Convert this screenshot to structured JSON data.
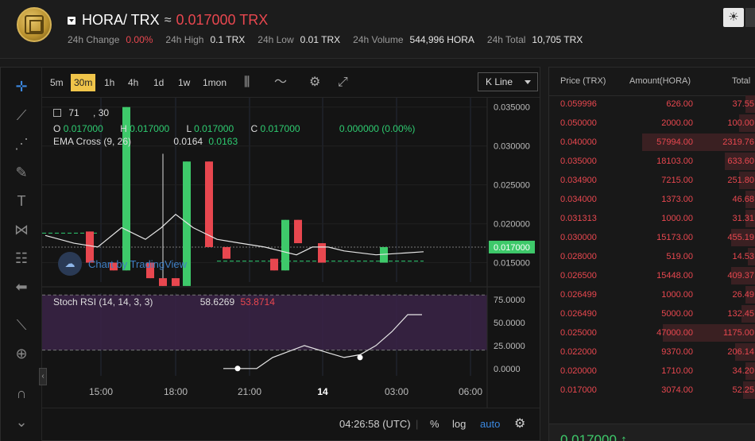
{
  "header": {
    "pair": "HORA/ TRX",
    "approx": "≈",
    "price": "0.017000 TRX",
    "stats": [
      {
        "label": "24h Change",
        "value": "0.00%",
        "red": true
      },
      {
        "label": "24h High",
        "value": "0.1 TRX"
      },
      {
        "label": "24h Low",
        "value": "0.01 TRX"
      },
      {
        "label": "24h Volume",
        "value": "544,996 HORA"
      },
      {
        "label": "24h Total",
        "value": "10,705 TRX"
      }
    ],
    "theme_icon": "sun-icon"
  },
  "toolbar": {
    "timeframes": [
      "5m",
      "30m",
      "1h",
      "4h",
      "1d",
      "1w",
      "1mon"
    ],
    "active_timeframe": "30m",
    "chart_type": "K Line"
  },
  "legend": {
    "volume_a": "71",
    "volume_b": ", 30",
    "o_label": "O",
    "o": "0.017000",
    "h_label": "H",
    "h": "0.017000",
    "l_label": "L",
    "l": "0.017000",
    "c_label": "C",
    "c": "0.017000",
    "change": "0.000000 (0.00%)",
    "ema_label": "EMA Cross (9, 26)",
    "ema_a": "0.0164",
    "ema_b": "0.0163"
  },
  "rsi": {
    "label": "Stoch RSI (14, 14, 3, 3)",
    "k": "58.6269",
    "d": "53.8714"
  },
  "watermark": "Chart by TradingView",
  "bottom": {
    "time": "04:26:58 (UTC)",
    "percent": "%",
    "log": "log",
    "auto": "auto"
  },
  "colors": {
    "up": "#3ec96a",
    "down": "#e8474f",
    "accent": "#f0c54a",
    "rsi_band": "#3a2347"
  },
  "chart_data": [
    {
      "type": "candlestick",
      "title": "",
      "x_ticks": [
        "15:00",
        "18:00",
        "21:00",
        "14",
        "03:00",
        "06:00"
      ],
      "y_ticks": [
        "0.035000",
        "0.030000",
        "0.025000",
        "0.020000",
        "0.015000"
      ],
      "ylim": [
        0.0125,
        0.0362
      ],
      "last_price_label": "0.017000",
      "candles": [
        {
          "o": 0.019,
          "h": 0.019,
          "l": 0.015,
          "c": 0.015
        },
        {
          "o": 0.015,
          "h": 0.015,
          "l": 0.014,
          "c": 0.014
        },
        {
          "o": 0.014,
          "h": 0.035,
          "l": 0.014,
          "c": 0.035
        },
        {
          "o": 0.015,
          "h": 0.015,
          "l": 0.013,
          "c": 0.013
        },
        {
          "o": 0.013,
          "h": 0.029,
          "l": 0.012,
          "c": 0.012
        },
        {
          "o": 0.013,
          "h": 0.013,
          "l": 0.012,
          "c": 0.012
        },
        {
          "o": 0.012,
          "h": 0.028,
          "l": 0.012,
          "c": 0.028
        },
        {
          "o": 0.028,
          "h": 0.028,
          "l": 0.017,
          "c": 0.017
        },
        {
          "o": 0.017,
          "h": 0.017,
          "l": 0.0155,
          "c": 0.0155
        },
        {
          "o": 0.0155,
          "h": 0.0155,
          "l": 0.014,
          "c": 0.014
        },
        {
          "o": 0.014,
          "h": 0.0205,
          "l": 0.014,
          "c": 0.0205
        },
        {
          "o": 0.0205,
          "h": 0.0205,
          "l": 0.0175,
          "c": 0.0175
        },
        {
          "o": 0.0175,
          "h": 0.0175,
          "l": 0.015,
          "c": 0.015
        },
        {
          "o": 0.015,
          "h": 0.017,
          "l": 0.015,
          "c": 0.017
        }
      ],
      "ema_line": [
        0.0185,
        0.0175,
        0.017,
        0.0195,
        0.018,
        0.0195,
        0.0212,
        0.0195,
        0.018,
        0.0175,
        0.017,
        0.0165,
        0.016,
        0.017,
        0.017,
        0.0165,
        0.016,
        0.0162,
        0.0164
      ]
    },
    {
      "type": "line",
      "title": "",
      "y_ticks": [
        "75.0000",
        "50.0000",
        "25.0000",
        "0.0000"
      ],
      "ylim": [
        -8,
        82
      ],
      "series": [
        {
          "values": [
            0,
            0,
            0,
            0,
            12,
            25,
            17,
            12,
            15,
            25,
            40,
            58.6,
            58.6
          ]
        }
      ]
    }
  ],
  "orderbook": {
    "headers": [
      "Price (TRX)",
      "Amount(HORA)",
      "Total"
    ],
    "rows": [
      {
        "price": "0.059996",
        "amount": "626.00",
        "total": "37.55",
        "depth": 0.05
      },
      {
        "price": "0.050000",
        "amount": "2000.00",
        "total": "100.00",
        "depth": 0.08
      },
      {
        "price": "0.040000",
        "amount": "57994.00",
        "total": "2319.76",
        "depth": 0.55
      },
      {
        "price": "0.035000",
        "amount": "18103.00",
        "total": "633.60",
        "depth": 0.15
      },
      {
        "price": "0.034900",
        "amount": "7215.00",
        "total": "251.80",
        "depth": 0.08
      },
      {
        "price": "0.034000",
        "amount": "1373.00",
        "total": "46.68",
        "depth": 0.05
      },
      {
        "price": "0.031313",
        "amount": "1000.00",
        "total": "31.31",
        "depth": 0.05
      },
      {
        "price": "0.030000",
        "amount": "15173.00",
        "total": "455.19",
        "depth": 0.12
      },
      {
        "price": "0.028000",
        "amount": "519.00",
        "total": "14.53",
        "depth": 0.04
      },
      {
        "price": "0.026500",
        "amount": "15448.00",
        "total": "409.37",
        "depth": 0.12
      },
      {
        "price": "0.026499",
        "amount": "1000.00",
        "total": "26.49",
        "depth": 0.05
      },
      {
        "price": "0.026490",
        "amount": "5000.00",
        "total": "132.45",
        "depth": 0.07
      },
      {
        "price": "0.025000",
        "amount": "47000.00",
        "total": "1175.00",
        "depth": 0.45
      },
      {
        "price": "0.022000",
        "amount": "9370.00",
        "total": "206.14",
        "depth": 0.1
      },
      {
        "price": "0.020000",
        "amount": "1710.00",
        "total": "34.20",
        "depth": 0.05
      },
      {
        "price": "0.017000",
        "amount": "3074.00",
        "total": "52.25",
        "depth": 0.06
      }
    ],
    "last_price": "0.017000 ↑"
  }
}
